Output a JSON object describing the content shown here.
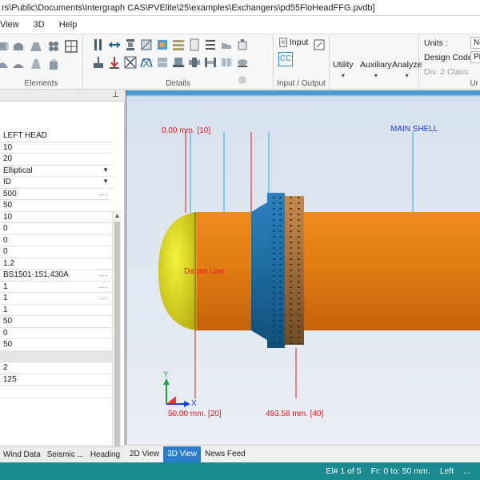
{
  "window": {
    "title": "rs\\Public\\Documents\\Intergraph CAS\\PVElite\\25\\examples\\Exchangers\\pd55FloHeadFFG.pvdb]"
  },
  "ribbon_tabs": [
    "View",
    "3D",
    "Help"
  ],
  "ribbon": {
    "groups": {
      "elements": "Elements",
      "details": "Details",
      "io": "Input / Output",
      "units_group": "Ur"
    },
    "input_label": "Input",
    "cc_label": "CC",
    "utility": "Utility",
    "auxiliary": "Auxiliary",
    "analyze": "Analyze",
    "units_label": "Units :",
    "units_value": "Ne",
    "design_code_label": "Design Code :",
    "design_code_value": "PD",
    "div2_label": "Div. 2 Class:"
  },
  "properties": {
    "rows": [
      {
        "value": "LEFT HEAD",
        "kind": "text"
      },
      {
        "value": "10",
        "kind": "text"
      },
      {
        "value": "20",
        "kind": "text"
      },
      {
        "value": "Elliptical",
        "kind": "dropdown"
      },
      {
        "value": "ID",
        "kind": "dropdown"
      },
      {
        "value": "500",
        "kind": "ellipsis"
      },
      {
        "value": "50",
        "kind": "text"
      },
      {
        "value": "10",
        "kind": "text"
      },
      {
        "value": "0",
        "kind": "text"
      },
      {
        "value": "0",
        "kind": "text"
      },
      {
        "value": "0",
        "kind": "text"
      },
      {
        "value": "1.2",
        "kind": "text"
      },
      {
        "value": "BS1501-151,430A",
        "kind": "ellipsis"
      },
      {
        "value": "1",
        "kind": "ellipsis"
      },
      {
        "value": "1",
        "kind": "ellipsis"
      },
      {
        "value": "1",
        "kind": "text"
      },
      {
        "value": "50",
        "kind": "text"
      },
      {
        "value": "0",
        "kind": "text"
      },
      {
        "value": "50",
        "kind": "text"
      },
      {
        "value": "",
        "kind": "grey"
      },
      {
        "value": "2",
        "kind": "text"
      },
      {
        "value": "125",
        "kind": "text"
      },
      {
        "value": "",
        "kind": "text"
      }
    ]
  },
  "left_bottom_tabs": [
    "Wind Data",
    "Seismic ...",
    "Heading"
  ],
  "viewport": {
    "label_top_left": "0.00 mm.  [10]",
    "label_main_shell": "MAIN SHELL",
    "label_datum": "Datum Line",
    "label_bottom_left": "50.00 mm.  [20]",
    "label_bottom_right": "493.58 mm.  [40]",
    "axis_x": "X",
    "axis_y": "Y",
    "colors": {
      "shell": "#e07a12",
      "head": "#dede1a",
      "flange": "#1c6aa0",
      "dim_line": "#e01b1b",
      "marker_line": "#19b8d9"
    }
  },
  "view_tabs": [
    "2D View",
    "3D View",
    "News Feed"
  ],
  "status": {
    "element": "El# 1 of 5",
    "from_to": "Fr: 0 to: 50 mm.",
    "side": "Left",
    "more": "..."
  }
}
